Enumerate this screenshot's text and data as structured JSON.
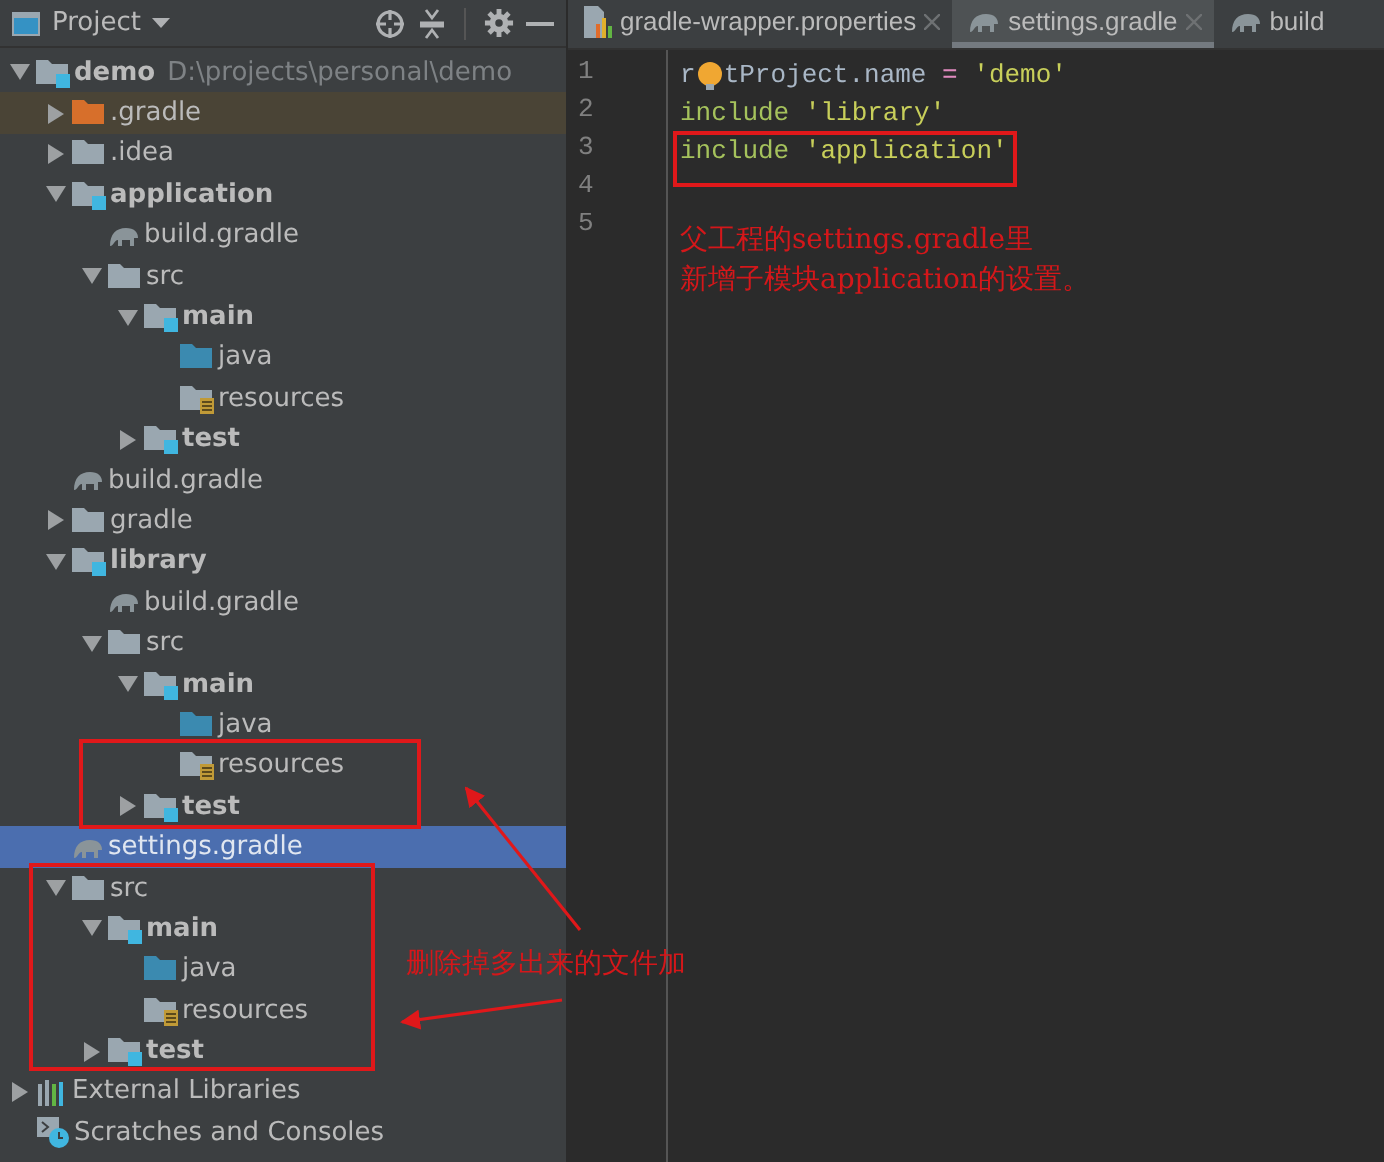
{
  "project_panel": {
    "title": "Project"
  },
  "tree": [
    {
      "label": "demo",
      "path": "D:\\projects\\personal\\demo",
      "kind": "module",
      "expanded": true,
      "selected": false,
      "children": [
        {
          "label": ".gradle",
          "kind": "excluded-folder",
          "expanded": false,
          "selected": false
        },
        {
          "label": ".idea",
          "kind": "folder",
          "expanded": false,
          "selected": false
        },
        {
          "label": "application",
          "kind": "module",
          "expanded": true,
          "selected": false,
          "children": [
            {
              "label": "build.gradle",
              "kind": "gradle-file",
              "selected": false
            },
            {
              "label": "src",
              "kind": "folder",
              "expanded": true,
              "selected": false,
              "children": [
                {
                  "label": "main",
                  "kind": "module",
                  "expanded": true,
                  "selected": false,
                  "children": [
                    {
                      "label": "java",
                      "kind": "source-folder",
                      "selected": false
                    },
                    {
                      "label": "resources",
                      "kind": "resources-folder",
                      "selected": false
                    }
                  ]
                },
                {
                  "label": "test",
                  "kind": "module",
                  "expanded": false,
                  "selected": false
                }
              ]
            }
          ]
        },
        {
          "label": "build.gradle",
          "kind": "gradle-file",
          "selected": false
        },
        {
          "label": "gradle",
          "kind": "folder",
          "expanded": false,
          "selected": false
        },
        {
          "label": "library",
          "kind": "module",
          "expanded": true,
          "selected": false,
          "children": [
            {
              "label": "build.gradle",
              "kind": "gradle-file",
              "selected": false
            },
            {
              "label": "src",
              "kind": "folder",
              "expanded": true,
              "selected": false,
              "children": [
                {
                  "label": "main",
                  "kind": "module",
                  "expanded": true,
                  "selected": false,
                  "children": [
                    {
                      "label": "java",
                      "kind": "source-folder",
                      "selected": false
                    },
                    {
                      "label": "resources",
                      "kind": "resources-folder",
                      "selected": false
                    }
                  ]
                },
                {
                  "label": "test",
                  "kind": "module",
                  "expanded": false,
                  "selected": false
                }
              ]
            }
          ]
        },
        {
          "label": "settings.gradle",
          "kind": "gradle-file",
          "selected": true
        },
        {
          "label": "src",
          "kind": "folder",
          "expanded": true,
          "selected": false,
          "children": [
            {
              "label": "main",
              "kind": "module",
              "expanded": true,
              "selected": false,
              "children": [
                {
                  "label": "java",
                  "kind": "source-folder",
                  "selected": false
                },
                {
                  "label": "resources",
                  "kind": "resources-folder",
                  "selected": false
                }
              ]
            },
            {
              "label": "test",
              "kind": "module",
              "expanded": false,
              "selected": false
            }
          ]
        }
      ]
    },
    {
      "label": "External Libraries",
      "kind": "libraries",
      "expanded": false,
      "selected": false
    },
    {
      "label": "Scratches and Consoles",
      "kind": "scratches",
      "selected": false
    }
  ],
  "editor_tabs": [
    {
      "label": "gradle-wrapper.properties",
      "kind": "properties",
      "selected": false,
      "closable": true
    },
    {
      "label": "settings.gradle",
      "kind": "gradle",
      "selected": true,
      "closable": true
    },
    {
      "label": "build",
      "kind": "gradle",
      "selected": false,
      "closable": false
    }
  ],
  "editor_lines": [
    {
      "number": "1",
      "tokens": [
        {
          "kind": "plain",
          "text": "r"
        },
        {
          "kind": "bulb"
        },
        {
          "kind": "plain",
          "text": "tProject.name "
        },
        {
          "kind": "operator",
          "text": "="
        },
        {
          "kind": "string",
          "text": " 'demo'"
        }
      ]
    },
    {
      "number": "2",
      "tokens": [
        {
          "kind": "keyword",
          "text": "include "
        },
        {
          "kind": "string",
          "text": "'library'"
        }
      ]
    },
    {
      "number": "3",
      "tokens": [
        {
          "kind": "keyword",
          "text": "include "
        },
        {
          "kind": "string",
          "text": "'application'"
        }
      ]
    },
    {
      "number": "4"
    },
    {
      "number": "5"
    }
  ],
  "annotations": {
    "editor_note": [
      "父工程的settings.gradle里",
      "新增子模块application的设置。"
    ],
    "tree_note": "删除掉多出来的文件加"
  }
}
